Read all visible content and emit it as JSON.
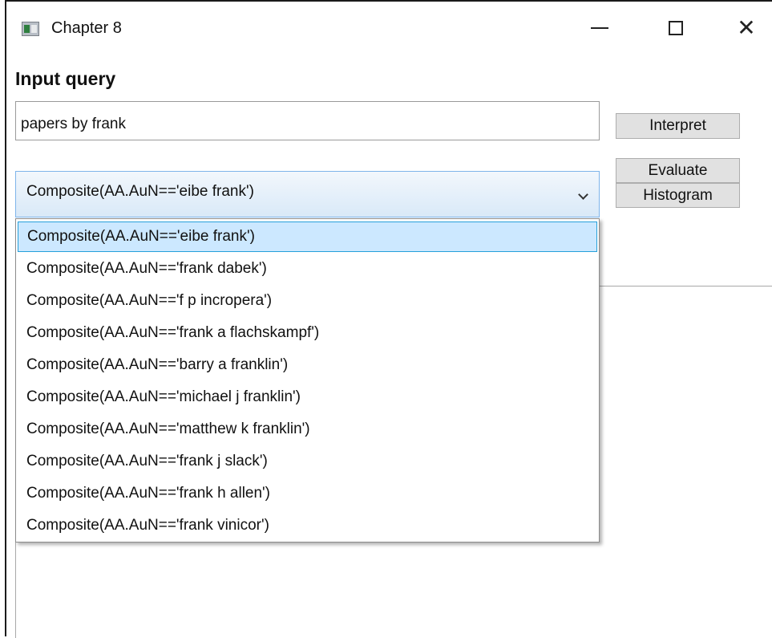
{
  "window": {
    "title": "Chapter 8",
    "icon": "app-window-icon"
  },
  "controls": {
    "minimize": "—",
    "maximize": "☐",
    "close": "✕"
  },
  "heading": "Input query",
  "query": {
    "value": "papers by frank"
  },
  "buttons": {
    "interpret": "Interpret",
    "evaluate": "Evaluate",
    "histogram": "Histogram"
  },
  "combo": {
    "selected": "Composite(AA.AuN=='eibe frank')"
  },
  "dropdown": {
    "items": [
      "Composite(AA.AuN=='eibe frank')",
      "Composite(AA.AuN=='frank dabek')",
      "Composite(AA.AuN=='f p incropera')",
      "Composite(AA.AuN=='frank a flachskampf')",
      "Composite(AA.AuN=='barry a franklin')",
      "Composite(AA.AuN=='michael j franklin')",
      "Composite(AA.AuN=='matthew k franklin')",
      "Composite(AA.AuN=='frank j slack')",
      "Composite(AA.AuN=='frank h allen')",
      "Composite(AA.AuN=='frank vinicor')"
    ],
    "selected_index": 0
  },
  "colors": {
    "selection": "#cce8ff",
    "selection_border": "#26a0da",
    "combo_border": "#7eb4ea"
  }
}
